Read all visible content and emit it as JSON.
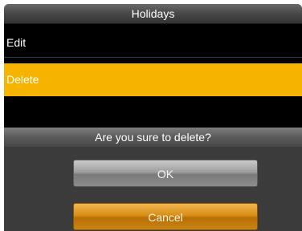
{
  "title_bar": {
    "title": "Holidays"
  },
  "menu": {
    "items": [
      {
        "label": "Edit",
        "selected": false
      },
      {
        "label": "Delete",
        "selected": true
      }
    ]
  },
  "dialog": {
    "message": "Are you sure to delete?",
    "ok_label": "OK",
    "cancel_label": "Cancel"
  },
  "colors": {
    "selection_highlight": "#f6b400",
    "screen_background": "#000000",
    "dialog_background": "#3b3b3b",
    "ok_button": "#9e9e9e",
    "cancel_button": "#d88e16"
  }
}
